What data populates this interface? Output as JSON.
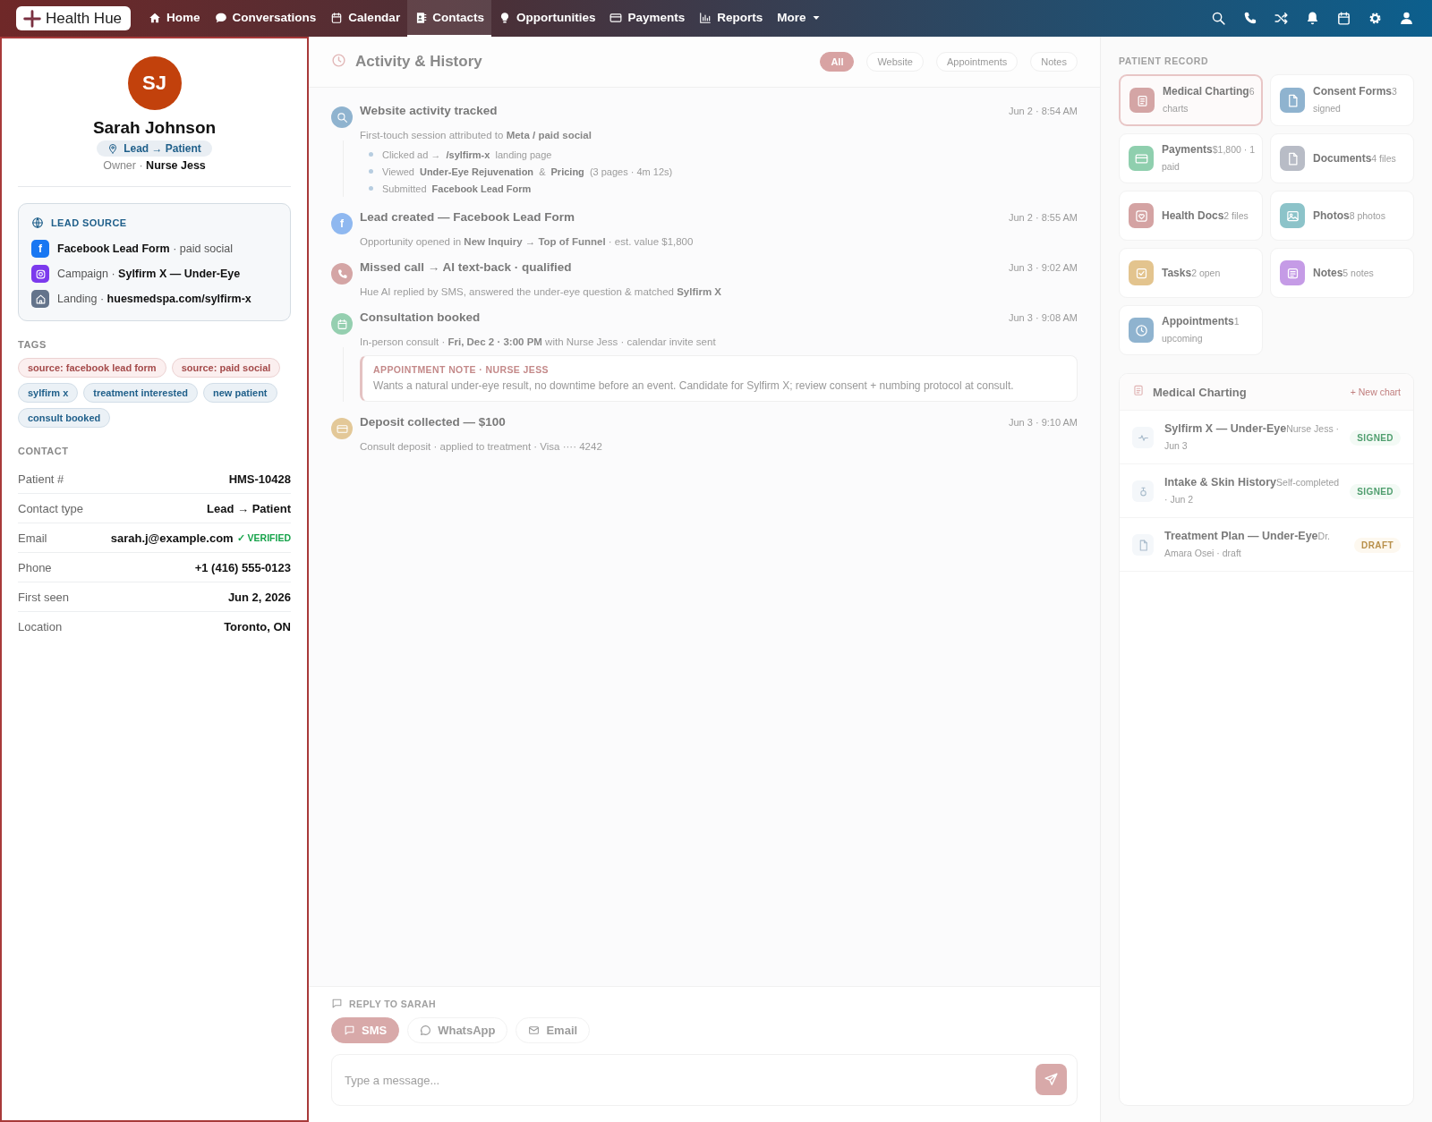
{
  "nav": {
    "brand": "Health Hue",
    "items": [
      {
        "label": "Home",
        "selected": false
      },
      {
        "label": "Conversations",
        "selected": false
      },
      {
        "label": "Calendar",
        "selected": false
      },
      {
        "label": "Contacts",
        "selected": true
      },
      {
        "label": "Opportunities",
        "selected": false
      },
      {
        "label": "Payments",
        "selected": false
      },
      {
        "label": "Reports",
        "selected": false
      }
    ],
    "more": "More"
  },
  "profile": {
    "initials": "SJ",
    "name": "Sarah Johnson",
    "stage": "Lead → Patient",
    "owner": "Owner · **Nurse Jess**"
  },
  "lead_source": {
    "title": "LEAD SOURCE",
    "rows": [
      {
        "text": "**Facebook Lead Form** · paid social",
        "color": "#1877f2",
        "icon_text": "f"
      },
      {
        "text": "Campaign · **Sylfirm X — Under-Eye**",
        "color": "#7c3aed"
      },
      {
        "text": "Landing · **huesmedspa.com/sylfirm-x**",
        "color": "#64748b"
      }
    ]
  },
  "tags": {
    "title": "TAGS",
    "items": [
      {
        "label": "source: facebook lead form",
        "kind": "source"
      },
      {
        "label": "source: paid social",
        "kind": "source"
      },
      {
        "label": "sylfirm x",
        "kind": "interest"
      },
      {
        "label": "treatment interested",
        "kind": "interest"
      },
      {
        "label": "new patient",
        "kind": "interest"
      },
      {
        "label": "consult booked",
        "kind": "interest"
      }
    ]
  },
  "contact": {
    "title": "CONTACT",
    "fields": [
      {
        "label": "Patient #",
        "value": "HMS-10428"
      },
      {
        "label": "Contact type",
        "value": "Lead → Patient"
      },
      {
        "label": "Email",
        "value": "sarah.j@example.com",
        "badge": "✓ VERIFIED"
      },
      {
        "label": "Phone",
        "value": "+1 (416) 555-0123"
      },
      {
        "label": "First seen",
        "value": "Jun 2, 2026"
      },
      {
        "label": "Location",
        "value": "Toronto, ON"
      }
    ]
  },
  "activity": {
    "title": "Activity & History",
    "filters": [
      {
        "label": "All",
        "selected": true
      },
      {
        "label": "Website",
        "selected": false
      },
      {
        "label": "Appointments",
        "selected": false
      },
      {
        "label": "Notes",
        "selected": false
      }
    ],
    "events": [
      {
        "kind": "website",
        "color": "#8fb3cf",
        "title": "Website activity tracked",
        "detail": "First-touch session attributed to **Meta / paid social**",
        "time": "Jun 2 · 8:54 AM",
        "steps": [
          "Clicked ad → **/sylfirm-x** landing page",
          "Viewed **Under-Eye Rejuvenation** & **Pricing** (3 pages · 4m 12s)",
          "Submitted **Facebook Lead Form**"
        ]
      },
      {
        "kind": "facebook",
        "color": "#8fb8f0",
        "icon_text": "f",
        "title": "Lead created — Facebook Lead Form",
        "detail": "Opportunity opened in **New Inquiry → Top of Funnel** · est. value $1,800",
        "time": "Jun 2 · 8:55 AM"
      },
      {
        "kind": "call",
        "color": "#d4a5a5",
        "title": "Missed call → AI text-back · qualified",
        "detail": "Hue AI replied by SMS, answered the under-eye question & matched **Sylfirm X**",
        "time": "Jun 3 · 9:02 AM"
      },
      {
        "kind": "calendar",
        "color": "#95cfb0",
        "title": "Consultation booked",
        "detail": "In-person consult · **Fri, Dec 2 · 3:00 PM** with Nurse Jess · calendar invite sent",
        "time": "Jun 3 · 9:08 AM",
        "note": {
          "title": "APPOINTMENT NOTE · NURSE JESS",
          "text": "Wants a natural under-eye result, no downtime before an event. Candidate for Sylfirm X; review consent + numbing protocol at consult."
        }
      },
      {
        "kind": "payment",
        "color": "#e3c898",
        "title": "Deposit collected — $100",
        "detail": "Consult deposit · applied to treatment · Visa ···· 4242",
        "time": "Jun 3 · 9:10 AM"
      }
    ]
  },
  "reply": {
    "title": "REPLY TO SARAH",
    "channels": [
      {
        "label": "SMS",
        "selected": true
      },
      {
        "label": "WhatsApp",
        "selected": false
      },
      {
        "label": "Email",
        "selected": false
      }
    ],
    "placeholder": "Type a message..."
  },
  "record": {
    "title": "PATIENT RECORD",
    "tiles": [
      {
        "label": "Medical Charting",
        "meta": "6 charts",
        "color": "#d4a5a5",
        "selected": true
      },
      {
        "label": "Consent Forms",
        "meta": "3 signed",
        "color": "#8fb3cf",
        "selected": false
      },
      {
        "label": "Payments",
        "meta": "$1,800 · 1 paid",
        "color": "#8fcfae",
        "selected": false
      },
      {
        "label": "Documents",
        "meta": "4 files",
        "color": "#b8bcc6",
        "selected": false
      },
      {
        "label": "Health Docs",
        "meta": "2 files",
        "color": "#d4a3a3",
        "selected": false
      },
      {
        "label": "Photos",
        "meta": "8 photos",
        "color": "#8cc3c9",
        "selected": false
      },
      {
        "label": "Tasks",
        "meta": "2 open",
        "color": "#e3c48e",
        "selected": false
      },
      {
        "label": "Notes",
        "meta": "5 notes",
        "color": "#c59be6",
        "selected": false
      },
      {
        "label": "Appointments",
        "meta": "1 upcoming",
        "color": "#8fb3cf",
        "selected": false
      }
    ],
    "charting": {
      "title": "Medical Charting",
      "action": "+ New chart",
      "charts": [
        {
          "title": "Sylfirm X — Under-Eye",
          "meta": "Nurse Jess · Jun 3",
          "status": "SIGNED",
          "kind": "signed"
        },
        {
          "title": "Intake & Skin History",
          "meta": "Self-completed · Jun 2",
          "status": "SIGNED",
          "kind": "signed"
        },
        {
          "title": "Treatment Plan — Under-Eye",
          "meta": "Dr. Amara Osei · draft",
          "status": "DRAFT",
          "kind": "draft"
        }
      ]
    }
  }
}
